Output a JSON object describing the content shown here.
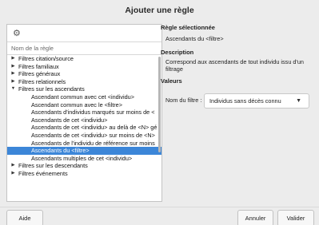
{
  "dialog": {
    "title": "Ajouter une règle"
  },
  "tree": {
    "toolbar_icon": "gear-icon",
    "column_header": "Nom de la règle",
    "rows": [
      {
        "label": "Filtres citation/source",
        "level": 0,
        "expander": "collapsed",
        "selected": false
      },
      {
        "label": "Filtres familiaux",
        "level": 0,
        "expander": "collapsed",
        "selected": false
      },
      {
        "label": "Filtres généraux",
        "level": 0,
        "expander": "collapsed",
        "selected": false
      },
      {
        "label": "Filtres relationnels",
        "level": 0,
        "expander": "collapsed",
        "selected": false
      },
      {
        "label": "Filtres sur les ascendants",
        "level": 0,
        "expander": "expanded",
        "selected": false
      },
      {
        "label": "Ascendant commun avec cet <individu>",
        "level": 1,
        "selected": false
      },
      {
        "label": "Ascendant commun avec le <filtre>",
        "level": 1,
        "selected": false
      },
      {
        "label": "Ascendants d'individus marqués sur moins de <",
        "level": 1,
        "selected": false
      },
      {
        "label": "Ascendants de cet <individu>",
        "level": 1,
        "selected": false
      },
      {
        "label": "Ascendants de cet <individu> au delà de <N> gé",
        "level": 1,
        "selected": false
      },
      {
        "label": "Ascendants de cet <individu> sur moins de <N>",
        "level": 1,
        "selected": false
      },
      {
        "label": "Ascendants de l'individu de référence sur moins",
        "level": 1,
        "selected": false
      },
      {
        "label": "Ascendants du <filtre>",
        "level": 1,
        "selected": true
      },
      {
        "label": "Ascendants multiples de cet <individu>",
        "level": 1,
        "selected": false
      },
      {
        "label": "Filtres sur les descendants",
        "level": 0,
        "expander": "collapsed",
        "selected": false
      },
      {
        "label": "Filtres événements",
        "level": 0,
        "expander": "collapsed",
        "selected": false
      }
    ]
  },
  "details": {
    "selected_rule_title": "Règle sélectionnée",
    "selected_rule_value": "Ascendants du <filtre>",
    "description_title": "Description",
    "description_text": "Correspond aux ascendants de tout individu issu d'un filtrage",
    "values_title": "Valeurs",
    "filter_name_label": "Nom du filtre :",
    "filter_name_value": "Individus sans décès connu"
  },
  "buttons": {
    "help": "Aide",
    "cancel": "Annuler",
    "ok": "Valider"
  },
  "colors": {
    "selection": "#3c86d8",
    "background": "#ececec"
  }
}
